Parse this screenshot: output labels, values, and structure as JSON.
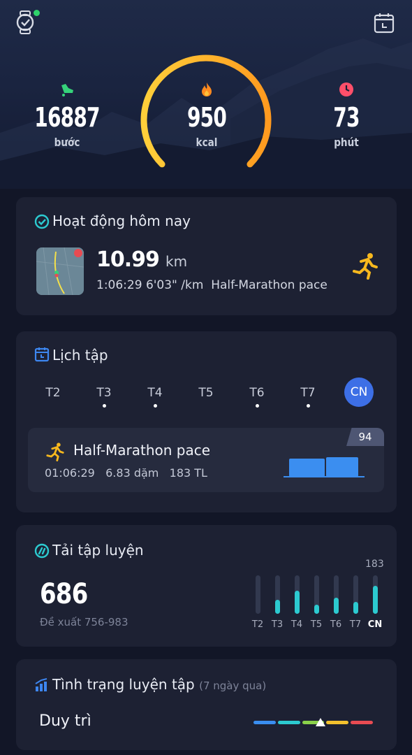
{
  "top": {
    "steps": {
      "value": "16887",
      "unit": "bước",
      "icon": "footprint-icon",
      "color": "#36d27a"
    },
    "calories": {
      "value": "950",
      "unit": "kcal",
      "icon": "flame-icon",
      "color": "#ff8a1f"
    },
    "minutes": {
      "value": "73",
      "unit": "phút",
      "icon": "clock-icon",
      "color": "#ff4f6a"
    },
    "calorie_ring_progress": 1.0,
    "ring_colors": [
      "#ffcf3a",
      "#ff9a1f"
    ]
  },
  "activity": {
    "title": "Hoạt động hôm nay",
    "distance": "10.99",
    "distance_unit": "km",
    "stats": "1:06:29 6'03\" /km  Half-Marathon pace",
    "icon": "runner-icon"
  },
  "schedule": {
    "title": "Lịch tập",
    "days": [
      {
        "label": "T2",
        "dot": false
      },
      {
        "label": "T3",
        "dot": true
      },
      {
        "label": "T4",
        "dot": true
      },
      {
        "label": "T5",
        "dot": false
      },
      {
        "label": "T6",
        "dot": true
      },
      {
        "label": "T7",
        "dot": true
      },
      {
        "label": "CN",
        "dot": false,
        "active": true
      }
    ],
    "workout": {
      "name": "Half-Marathon pace",
      "time": "01:06:29",
      "distance": "6.83 dặm",
      "load": "183 TL",
      "score": "94"
    }
  },
  "load": {
    "title": "Tải tập luyện",
    "value": "686",
    "suggestion": "Đề xuất 756-983",
    "max_label": "183",
    "days": [
      "T2",
      "T3",
      "T4",
      "T5",
      "T6",
      "T7",
      "CN"
    ],
    "fill_fractions": [
      0.0,
      0.36,
      0.6,
      0.24,
      0.42,
      0.3,
      0.72
    ],
    "accent": "#2ccad0"
  },
  "status": {
    "title": "Tình trạng luyện tập",
    "subtitle": "(7 ngày qua)",
    "value": "Duy trì",
    "scale_colors": [
      "#3a8ef0",
      "#2ccad0",
      "#8bd14a",
      "#f2c12e",
      "#e84b52"
    ],
    "marker_position": 0.56
  }
}
